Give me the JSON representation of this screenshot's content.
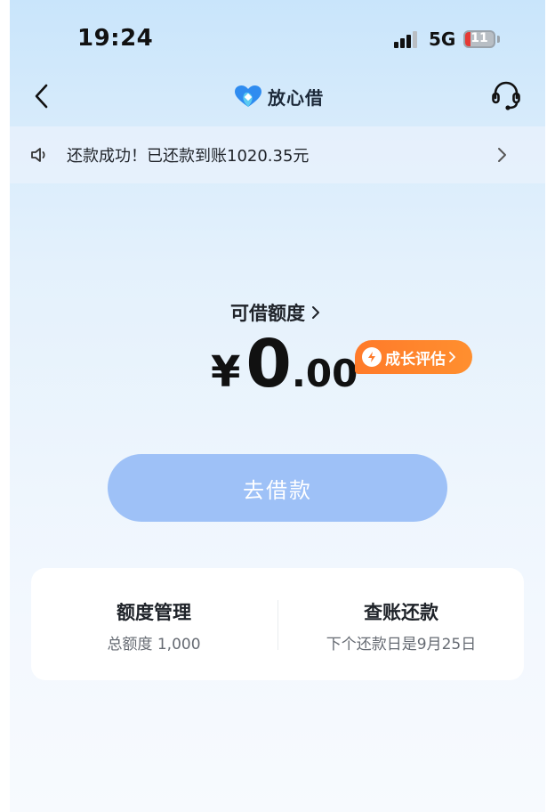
{
  "status_bar": {
    "time": "19:24",
    "network": "5G",
    "battery": "11"
  },
  "header": {
    "brand_name": "放心借"
  },
  "notice": {
    "message": "还款成功！已还款到账1020.35元"
  },
  "quota": {
    "label": "可借额度",
    "currency": "¥",
    "amount_integer": "0",
    "amount_decimal": ".00",
    "growth_badge": "成长评估"
  },
  "actions": {
    "borrow_label": "去借款"
  },
  "card": {
    "left_title": "额度管理",
    "left_sub": "总额度 1,000",
    "right_title": "查账还款",
    "right_sub": "下个还款日是9月25日"
  },
  "colors": {
    "accent_blue": "#9ec1f7",
    "badge_orange": "#ff7a2a",
    "battery_low": "#e53935"
  },
  "icons": {
    "back": "chevron-left-icon",
    "support": "headset-icon",
    "notice": "speaker-icon",
    "more": "chevron-right-icon",
    "growth": "bolt-icon"
  }
}
